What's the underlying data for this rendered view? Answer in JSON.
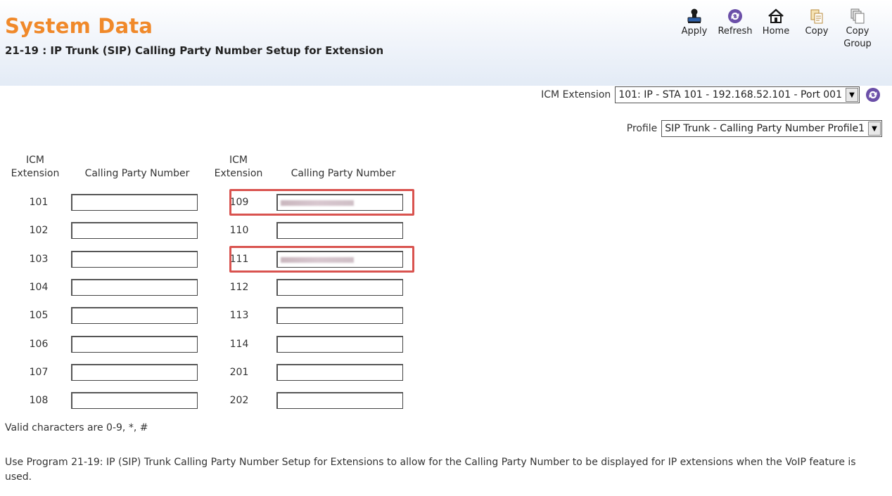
{
  "header": {
    "title": "System Data",
    "subtitle": "21-19 : IP Trunk (SIP) Calling Party Number Setup for Extension"
  },
  "toolbar": [
    {
      "label": "Apply",
      "icon": "apply-icon"
    },
    {
      "label": "Refresh",
      "icon": "refresh-icon"
    },
    {
      "label": "Home",
      "icon": "home-icon"
    },
    {
      "label": "Copy",
      "icon": "copy-icon"
    },
    {
      "label": "Copy Group",
      "icon": "copy-group-icon"
    }
  ],
  "selectors": {
    "extension_label": "ICM Extension",
    "extension_value": "101: IP - STA 101 - 192.168.52.101 - Port 001",
    "profile_label": "Profile",
    "profile_value": "SIP Trunk - Calling Party Number Profile1"
  },
  "table": {
    "col_ext_header": "ICM Extension",
    "col_cpn_header": "Calling Party Number",
    "left": [
      {
        "ext": "101",
        "value": ""
      },
      {
        "ext": "102",
        "value": ""
      },
      {
        "ext": "103",
        "value": ""
      },
      {
        "ext": "104",
        "value": ""
      },
      {
        "ext": "105",
        "value": ""
      },
      {
        "ext": "106",
        "value": ""
      },
      {
        "ext": "107",
        "value": ""
      },
      {
        "ext": "108",
        "value": ""
      }
    ],
    "right": [
      {
        "ext": "109",
        "value": "",
        "redacted": true
      },
      {
        "ext": "110",
        "value": ""
      },
      {
        "ext": "111",
        "value": "",
        "redacted": true
      },
      {
        "ext": "112",
        "value": ""
      },
      {
        "ext": "113",
        "value": ""
      },
      {
        "ext": "114",
        "value": ""
      },
      {
        "ext": "201",
        "value": ""
      },
      {
        "ext": "202",
        "value": ""
      }
    ]
  },
  "notes": {
    "valid_chars": "Valid characters are 0-9, *, #",
    "description": "Use Program 21-19: IP (SIP) Trunk Calling Party Number Setup for Extensions to allow for the Calling Party Number to be displayed for IP extensions when the VoIP feature is used."
  },
  "colors": {
    "title": "#f0892a",
    "highlight": "#d9534f",
    "refresh": "#6b4fa8"
  }
}
